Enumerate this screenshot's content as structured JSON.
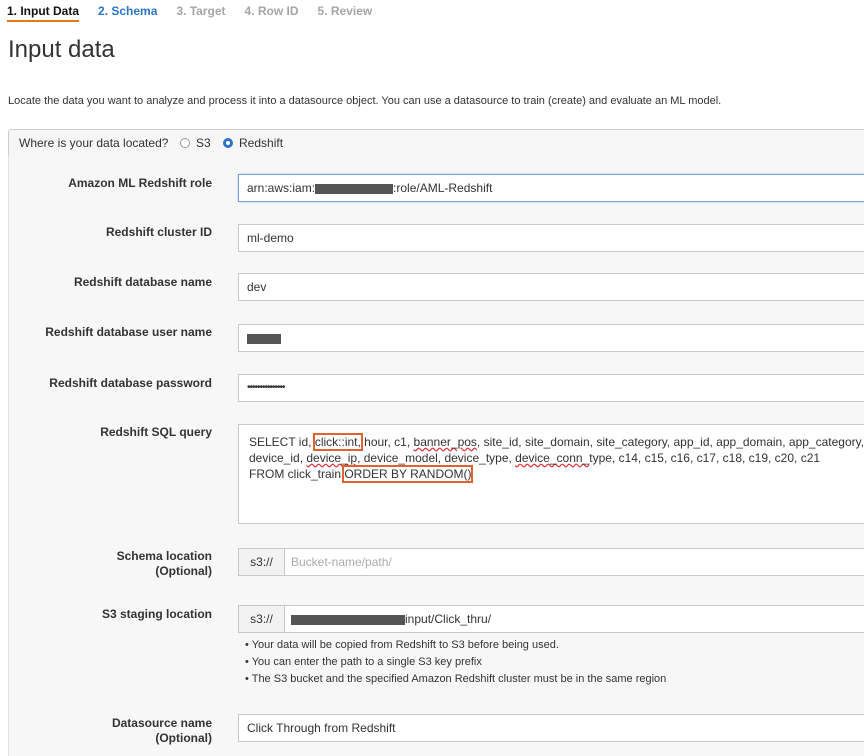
{
  "wizard": {
    "steps": [
      {
        "label": "1. Input Data",
        "state": "active"
      },
      {
        "label": "2. Schema",
        "state": "link"
      },
      {
        "label": "3. Target",
        "state": "disabled"
      },
      {
        "label": "4. Row ID",
        "state": "disabled"
      },
      {
        "label": "5. Review",
        "state": "disabled"
      }
    ]
  },
  "page": {
    "title": "Input data",
    "description": "Locate the data you want to analyze and process it into a datasource object. You can use a datasource to train (create) and evaluate an ML model."
  },
  "location": {
    "question": "Where is your data located?",
    "options": [
      {
        "label": "S3",
        "selected": false
      },
      {
        "label": "Redshift",
        "selected": true
      }
    ]
  },
  "form": {
    "role": {
      "label": "Amazon ML Redshift role",
      "prefix": "arn:aws:iam:",
      "suffix": ":role/AML-Redshift"
    },
    "cluster": {
      "label": "Redshift cluster ID",
      "value": "ml-demo"
    },
    "database": {
      "label": "Redshift database name",
      "value": "dev"
    },
    "user": {
      "label": "Redshift database user name"
    },
    "password": {
      "label": "Redshift database password",
      "value": "•••••••••••••••"
    },
    "sql": {
      "label": "Redshift SQL query",
      "parts": {
        "p1": "SELECT id, ",
        "p2": "click::int,",
        "p3": " hour, c1, ",
        "p4": "banner_pos",
        "p5": ", site_id, site_domain, site_category, app_id, app_domain, app_category,",
        "p6": "device_id, ",
        "p7": "device_ip",
        "p8": ", device_model, device_type, ",
        "p9": "device_conn_",
        "p10": "type, c14,  c15, c16, c17, c18, c19, c20, c21",
        "p11": "FROM click_train ",
        "p12": "ORDER BY RANDOM()"
      }
    },
    "schema": {
      "label": "Schema location",
      "optional": "(Optional)",
      "prefix": "s3://",
      "placeholder": "Bucket-name/path/"
    },
    "staging": {
      "label": "S3 staging location",
      "prefix": "s3://",
      "suffix": "input/Click_thru/",
      "notes": [
        "Your data will be copied from Redshift to S3 before being used.",
        "You can enter the path to a single S3 key prefix",
        "The S3 bucket and the specified Amazon Redshift cluster must be in the same region"
      ]
    },
    "datasource": {
      "label": "Datasource name",
      "optional": "(Optional)",
      "value": "Click Through from Redshift"
    }
  },
  "colors": {
    "accent": "#e47911",
    "link": "#2d74c4",
    "highlight": "#e2612c"
  }
}
